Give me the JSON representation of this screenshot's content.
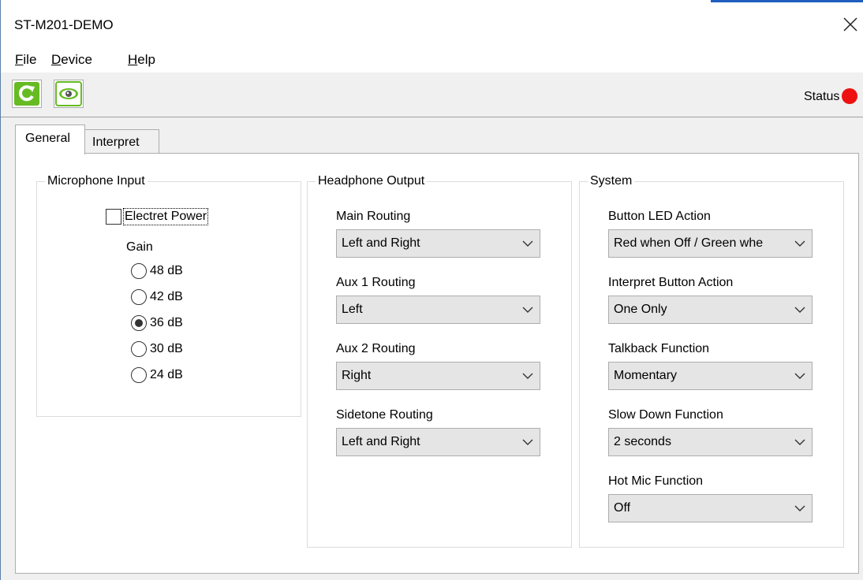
{
  "window": {
    "title": "ST-M201-DEMO"
  },
  "menu": {
    "file": "ile",
    "file_key": "F",
    "device": "evice",
    "device_key": "D",
    "help": "elp",
    "help_key": "H"
  },
  "toolbar": {
    "refresh_icon": "refresh-icon",
    "view_icon": "eye-icon"
  },
  "status": {
    "label": "Status",
    "led_color": "#ee1111"
  },
  "tabs": [
    {
      "label": "General",
      "active": true
    },
    {
      "label": "Interpret",
      "active": false
    }
  ],
  "microphone": {
    "legend": "Microphone Input",
    "electret_label": "Electret Power",
    "electret_checked": false,
    "gain_label": "Gain",
    "gain_options": [
      "48 dB",
      "42 dB",
      "36 dB",
      "30 dB",
      "24 dB"
    ],
    "gain_selected": "36 dB"
  },
  "headphone": {
    "legend": "Headphone Output",
    "main_label": "Main Routing",
    "main_value": "Left and Right",
    "aux1_label": "Aux 1 Routing",
    "aux1_value": "Left",
    "aux2_label": "Aux 2 Routing",
    "aux2_value": "Right",
    "sidetone_label": "Sidetone Routing",
    "sidetone_value": "Left and Right"
  },
  "system": {
    "legend": "System",
    "led_label": "Button LED Action",
    "led_value": "Red when Off / Green whe",
    "interpret_label": "Interpret Button Action",
    "interpret_value": "One Only",
    "talkback_label": "Talkback Function",
    "talkback_value": "Momentary",
    "slowdown_label": "Slow Down Function",
    "slowdown_value": "2 seconds",
    "hotmic_label": "Hot Mic Function",
    "hotmic_value": "Off"
  }
}
